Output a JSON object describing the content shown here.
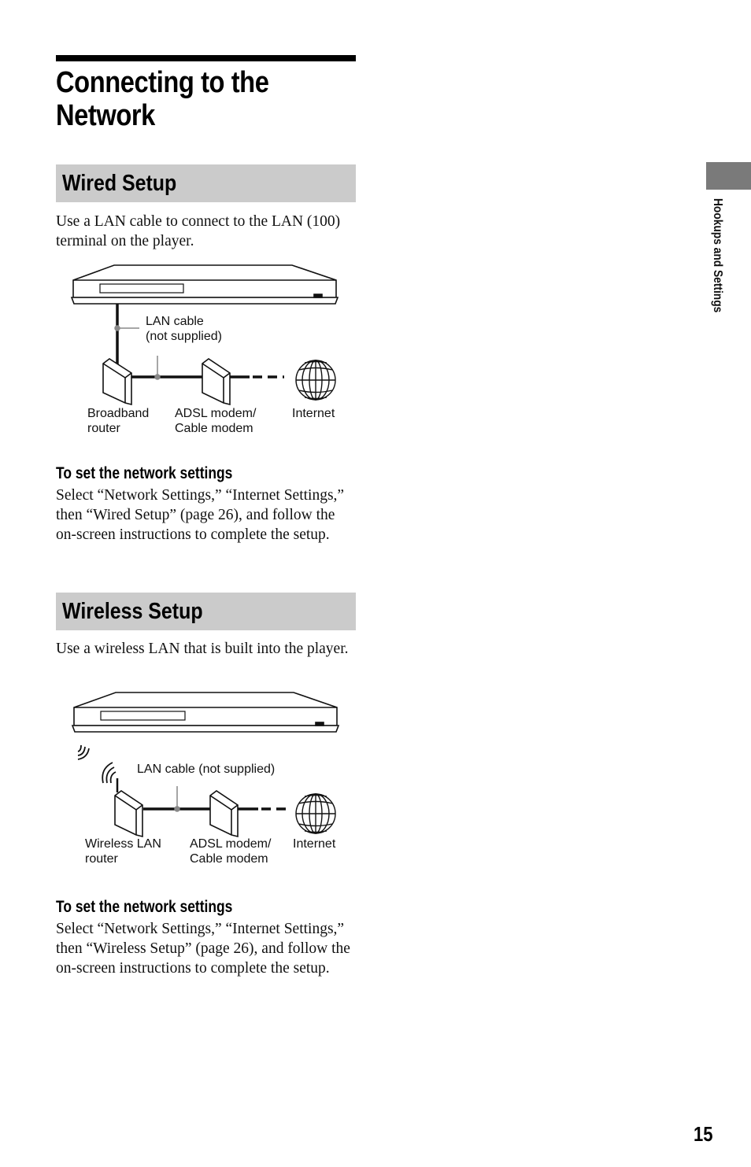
{
  "page": {
    "title": "Connecting to the Network",
    "page_number": "15",
    "side_tab_label": "Hookups and Settings"
  },
  "wired": {
    "heading": "Wired Setup",
    "intro": "Use a LAN cable to connect to the LAN (100) terminal on the player.",
    "diagram": {
      "cable_label": "LAN cable\n(not supplied)",
      "router_label": "Broadband\nrouter",
      "modem_label": "ADSL modem/\nCable modem",
      "internet_label": "Internet"
    },
    "settings_heading": "To set the network settings",
    "settings_text": "Select “Network Settings,” “Internet Settings,” then “Wired Setup” (page 26), and follow the on-screen instructions to complete the setup."
  },
  "wireless": {
    "heading": "Wireless Setup",
    "intro": "Use a wireless LAN that is built into the player.",
    "diagram": {
      "cable_label": "LAN cable (not supplied)",
      "router_label": "Wireless LAN\nrouter",
      "modem_label": "ADSL modem/\nCable modem",
      "internet_label": "Internet"
    },
    "settings_heading": "To set the network settings",
    "settings_text": "Select “Network Settings,” “Internet Settings,” then “Wireless Setup” (page 26), and follow the on-screen instructions to complete the setup."
  }
}
